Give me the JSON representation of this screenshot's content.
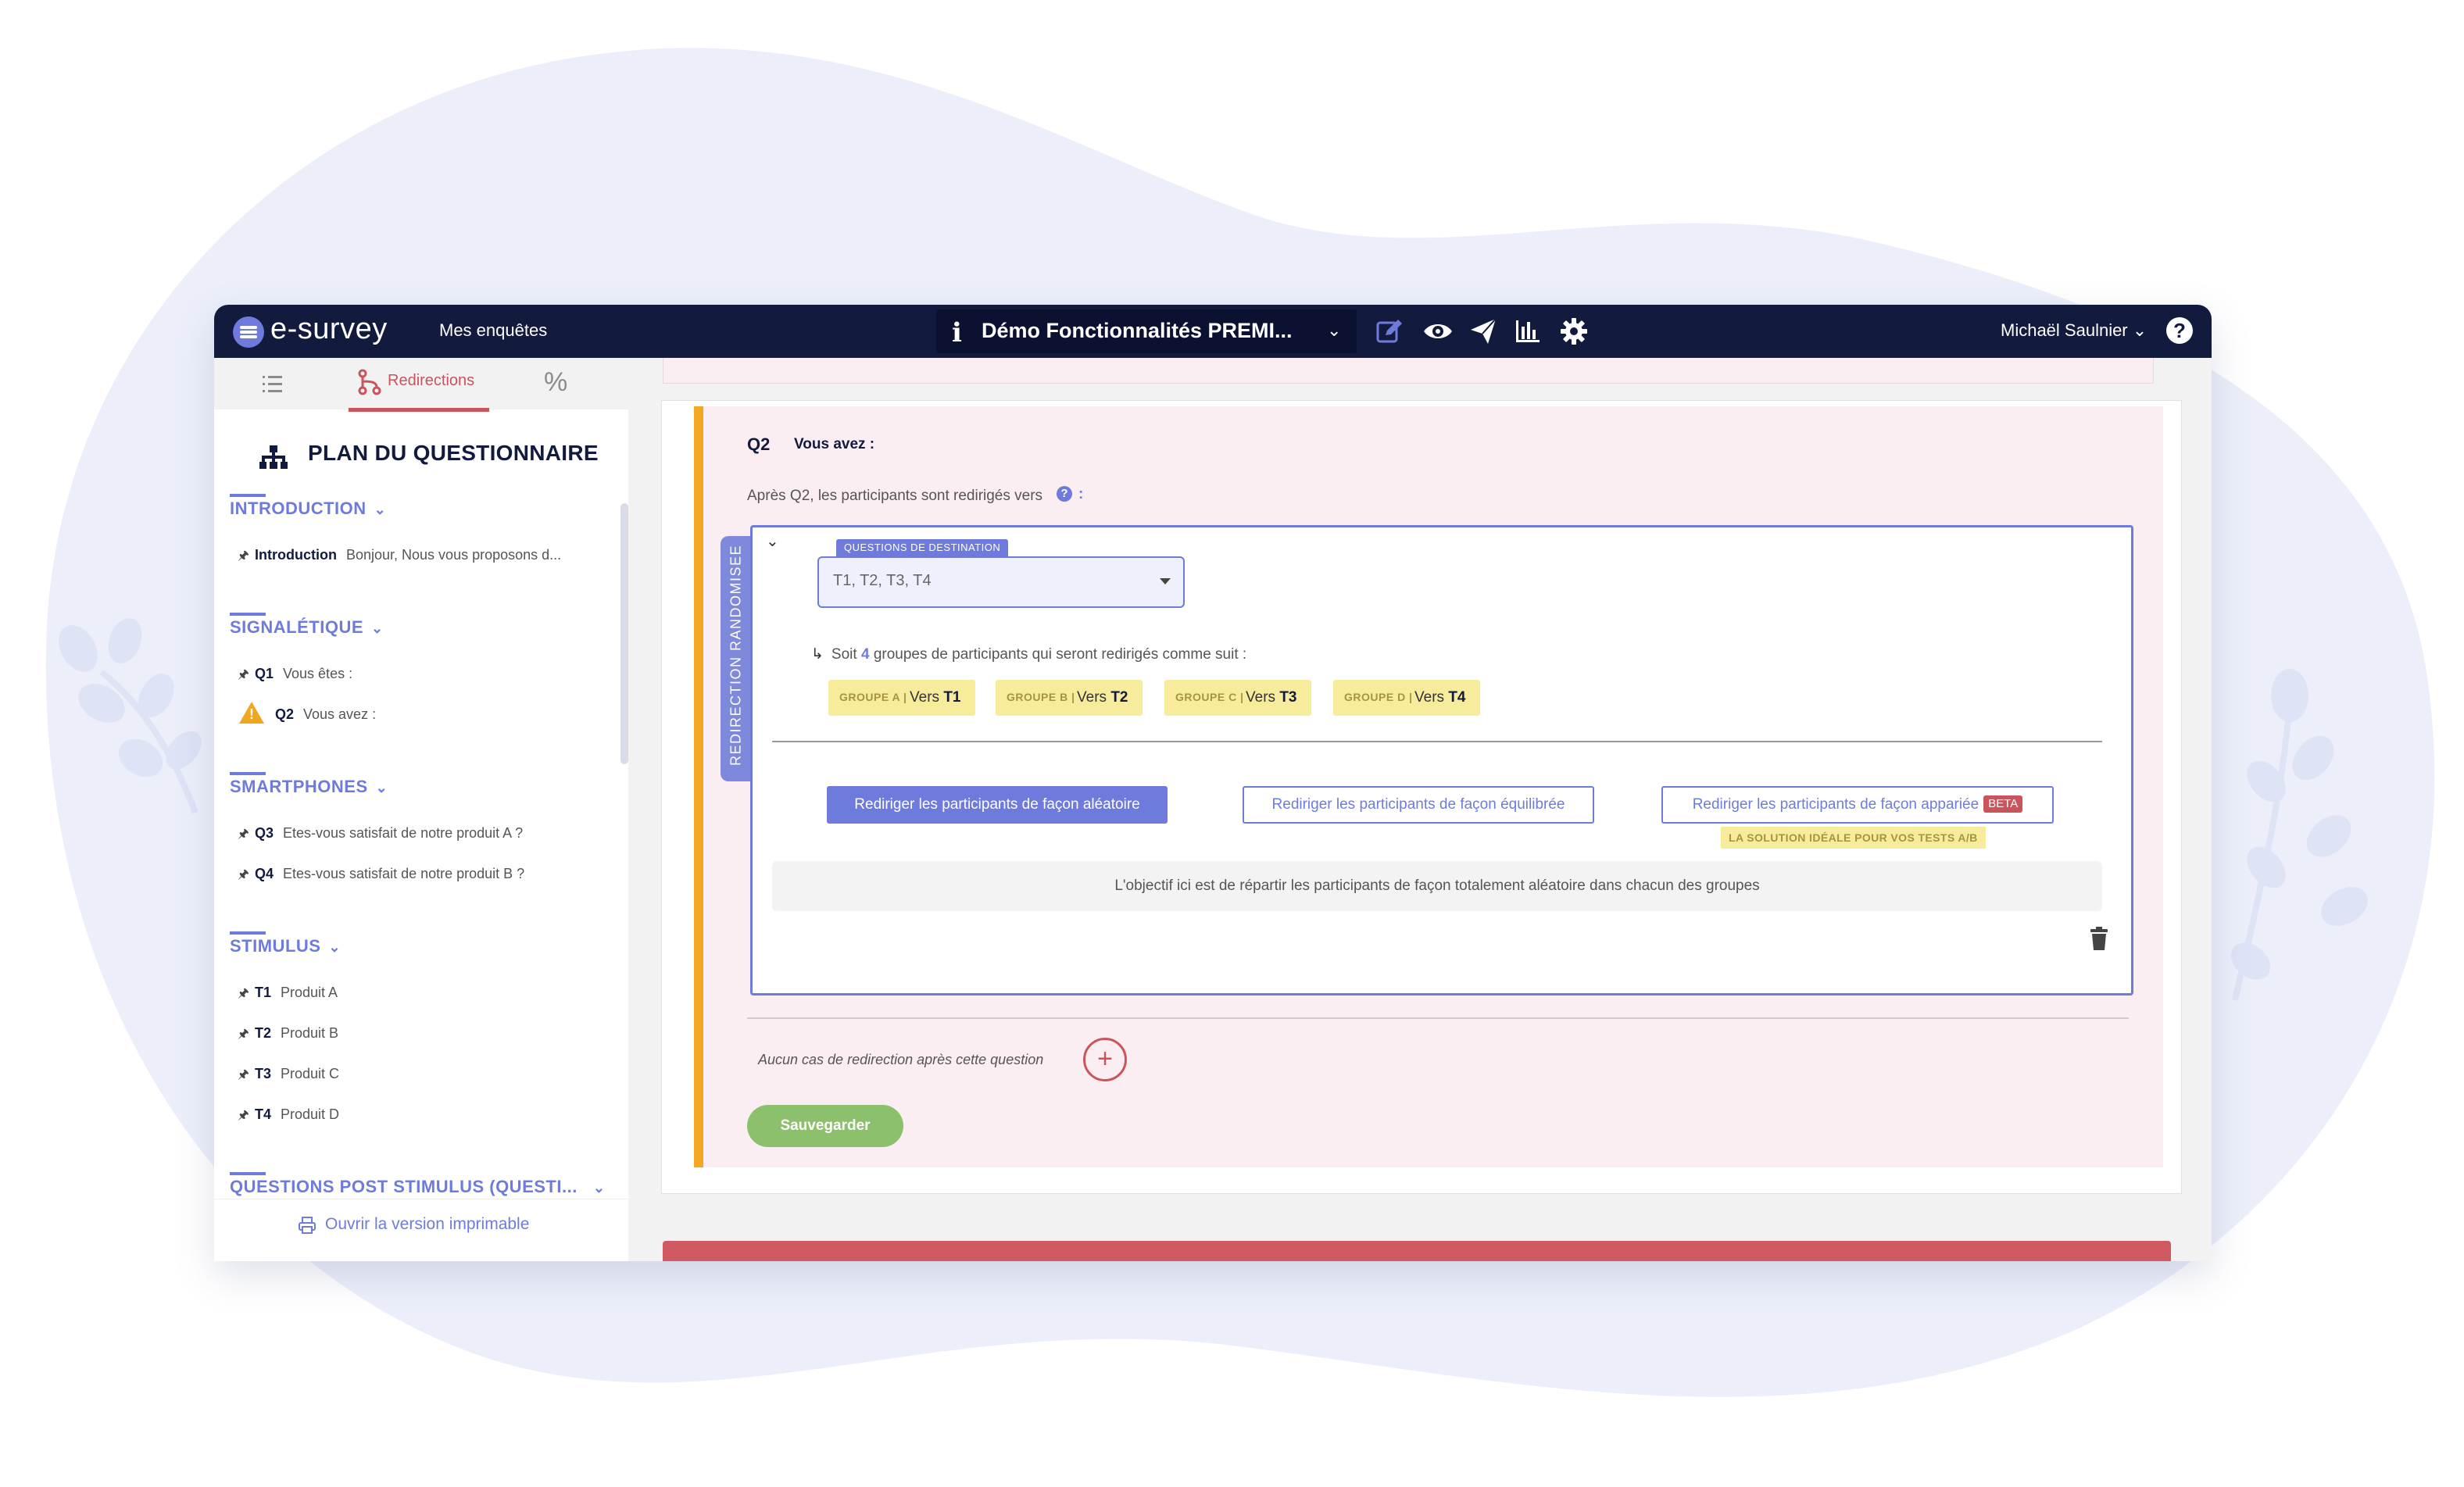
{
  "app": {
    "logo_text": "e-survey",
    "nav_link": "Mes enquêtes",
    "survey_info_icon": "i",
    "survey_title": "Démo Fonctionnalités PREMI...",
    "toolbar_icons": [
      "edit-icon",
      "eye-icon",
      "send-icon",
      "chart-icon",
      "gear-icon"
    ],
    "user_name": "Michaël Saulnier",
    "help_icon": "?"
  },
  "sidebar": {
    "tabs": [
      {
        "icon": "list-icon",
        "label": ""
      },
      {
        "icon": "redirect-icon",
        "label": "Redirections",
        "active": true
      },
      {
        "icon": "percent-icon",
        "label": "%"
      }
    ],
    "heading": "PLAN DU QUESTIONNAIRE",
    "sections": [
      {
        "title": "INTRODUCTION",
        "items": [
          {
            "code": "Introduction",
            "text": "Bonjour, Nous vous proposons d..."
          }
        ]
      },
      {
        "title": "SIGNALÉTIQUE",
        "items": [
          {
            "code": "Q1",
            "text": "Vous êtes :"
          },
          {
            "code": "Q2",
            "text": "Vous avez :",
            "warning": true
          }
        ]
      },
      {
        "title": "SMARTPHONES",
        "items": [
          {
            "code": "Q3",
            "text": "Etes-vous satisfait de notre produit A ?"
          },
          {
            "code": "Q4",
            "text": "Etes-vous satisfait de notre produit B ?"
          }
        ]
      },
      {
        "title": "STIMULUS",
        "items": [
          {
            "code": "T1",
            "text": "Produit A"
          },
          {
            "code": "T2",
            "text": "Produit B"
          },
          {
            "code": "T3",
            "text": "Produit C"
          },
          {
            "code": "T4",
            "text": "Produit D"
          }
        ]
      },
      {
        "title": "QUESTIONS POST STIMULUS (QUESTI...",
        "items": []
      }
    ],
    "footer_link": "Ouvrir la version imprimable"
  },
  "question": {
    "code": "Q2",
    "text": "Vous avez :",
    "after_text": "Après Q2, les participants sont redirigés vers",
    "after_colon": ":",
    "vertical_tab": "REDIRECTION RANDOMISEE",
    "destination_label": "QUESTIONS DE DESTINATION",
    "destination_value": "T1, T2, T3, T4",
    "groups_intro_prefix": "Soit",
    "groups_count": "4",
    "groups_intro_suffix": "groupes de participants qui seront redirigés comme suit :",
    "groups": [
      {
        "label": "GROUPE A |",
        "vers": "Vers",
        "target": "T1"
      },
      {
        "label": "GROUPE B |",
        "vers": "Vers",
        "target": "T2"
      },
      {
        "label": "GROUPE C |",
        "vers": "Vers",
        "target": "T3"
      },
      {
        "label": "GROUPE D |",
        "vers": "Vers",
        "target": "T4"
      }
    ],
    "buttons": {
      "random": "Rediriger les participants de façon aléatoire",
      "balanced": "Rediriger les participants de façon équilibrée",
      "paired": "Rediriger les participants de façon appariée",
      "beta": "BETA",
      "ab_note": "LA SOLUTION IDÉALE POUR VOS TESTS A/B"
    },
    "objective": "L'objectif ici est de répartir les participants de façon totalement aléatoire dans chacun des groupes",
    "no_redirect": "Aucun cas de redirection après cette question",
    "add_label": "+",
    "save": "Sauvegarder"
  },
  "colors": {
    "navy": "#121a3d",
    "accent": "#6f7bdc",
    "red": "#c9545c",
    "orange": "#f5a623",
    "green": "#8cc06c",
    "yellow_badge": "#f6ec9c",
    "card_pink": "#fbeef3"
  }
}
